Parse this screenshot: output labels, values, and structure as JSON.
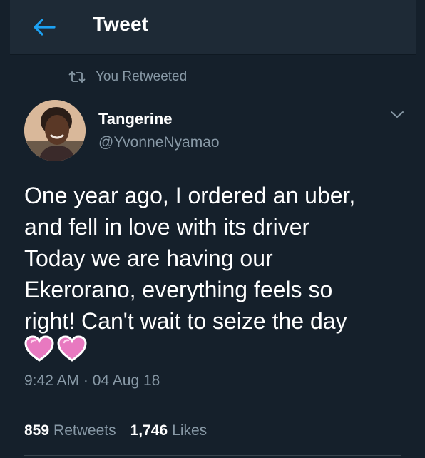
{
  "header": {
    "title": "Tweet",
    "back_icon": "arrow-left-icon"
  },
  "retweet_context": {
    "label": "You Retweeted",
    "icon": "retweet-icon"
  },
  "author": {
    "name": "Tangerine",
    "handle": "@YvonneNyamao"
  },
  "tweet": {
    "lines": [
      "One year ago, I ordered an uber,",
      "and fell in love with its driver",
      "Today we are having our",
      "Ekerorano, everything feels so",
      "right! Can't wait to seize the day"
    ],
    "emoji": [
      "💓",
      "💓"
    ],
    "time": "9:42 AM",
    "separator": "·",
    "date": "04 Aug 18"
  },
  "stats": {
    "retweets_count": "859",
    "retweets_label": "Retweets",
    "likes_count": "1,746",
    "likes_label": "Likes"
  },
  "colors": {
    "background": "#15202b",
    "header": "#1e2a36",
    "accent": "#1da1f2",
    "secondary_text": "#8899a6",
    "heart": "#e879c0"
  }
}
